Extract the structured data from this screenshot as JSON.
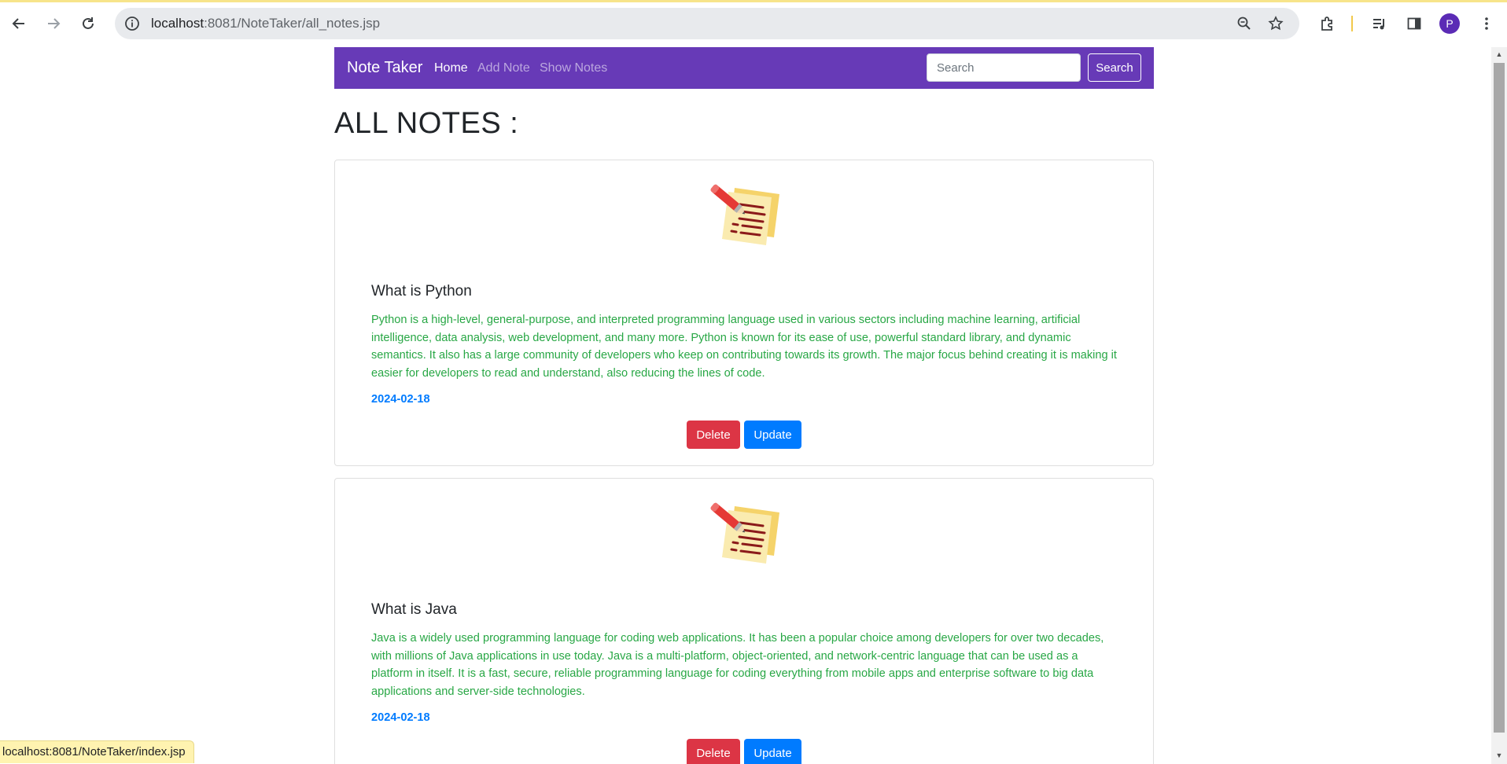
{
  "browser": {
    "url_host": "localhost",
    "url_rest": ":8081/NoteTaker/all_notes.jsp",
    "profile_initial": "P",
    "status_url": "localhost:8081/NoteTaker/index.jsp"
  },
  "navbar": {
    "brand": "Note Taker",
    "links": [
      {
        "label": "Home",
        "active": true
      },
      {
        "label": "Add Note",
        "active": false
      },
      {
        "label": "Show Notes",
        "active": false
      }
    ],
    "search_placeholder": "Search",
    "search_button": "Search",
    "color": "#673ab7"
  },
  "page": {
    "title": "ALL NOTES :"
  },
  "notes": [
    {
      "title": "What is Python",
      "content": "Python is a high-level, general-purpose, and interpreted programming language used in various sectors including machine learning, artificial intelligence, data analysis, web development, and many more. Python is known for its ease of use, powerful standard library, and dynamic semantics. It also has a large community of developers who keep on contributing towards its growth. The major focus behind creating it is making it easier for developers to read and understand, also reducing the lines of code.",
      "date": "2024-02-18",
      "delete_label": "Delete",
      "update_label": "Update"
    },
    {
      "title": "What is Java",
      "content": "Java is a widely used programming language for coding web applications. It has been a popular choice among developers for over two decades, with millions of Java applications in use today. Java is a multi-platform, object-oriented, and network-centric language that can be used as a platform in itself. It is a fast, secure, reliable programming language for coding everything from mobile apps and enterprise software to big data applications and server-side technologies.",
      "date": "2024-02-18",
      "delete_label": "Delete",
      "update_label": "Update"
    }
  ],
  "colors": {
    "note_text": "#28a745",
    "date_text": "#007bff",
    "delete_button": "#dc3545",
    "update_button": "#007bff"
  }
}
